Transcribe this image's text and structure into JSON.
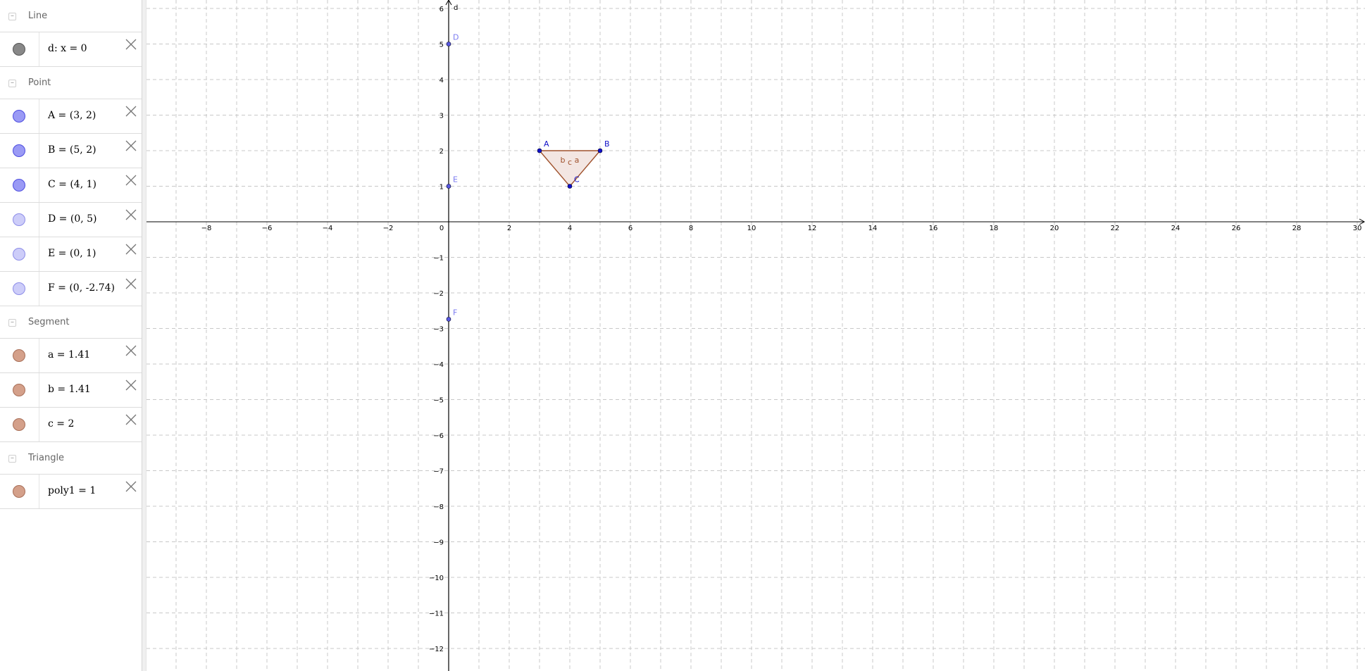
{
  "algebra": {
    "groups": [
      {
        "label": "Line",
        "items": [
          {
            "text": "d: x = 0",
            "color": "#888888",
            "border": "#555555"
          }
        ]
      },
      {
        "label": "Point",
        "items": [
          {
            "text": "A = (3, 2)",
            "color": "#9a9af5",
            "border": "#4d4de0"
          },
          {
            "text": "B = (5, 2)",
            "color": "#9a9af5",
            "border": "#4d4de0"
          },
          {
            "text": "C = (4, 1)",
            "color": "#9a9af5",
            "border": "#4d4de0"
          },
          {
            "text": "D = (0, 5)",
            "color": "#cdcdf9",
            "border": "#8d8de8"
          },
          {
            "text": "E = (0, 1)",
            "color": "#cdcdf9",
            "border": "#8d8de8"
          },
          {
            "text": "F = (0, -2.74)",
            "color": "#cdcdf9",
            "border": "#8d8de8"
          }
        ]
      },
      {
        "label": "Segment",
        "items": [
          {
            "text": "a = 1.41",
            "color": "#d4a08a",
            "border": "#a86f58"
          },
          {
            "text": "b = 1.41",
            "color": "#d4a08a",
            "border": "#a86f58"
          },
          {
            "text": "c = 2",
            "color": "#d4a08a",
            "border": "#a86f58"
          }
        ]
      },
      {
        "label": "Triangle",
        "items": [
          {
            "text": "poly1 = 1",
            "color": "#d4a08a",
            "border": "#a86f58"
          }
        ]
      }
    ]
  },
  "graphics": {
    "x_ticks": [
      "-8",
      "-6",
      "-4",
      "-2",
      "0",
      "2",
      "4",
      "6",
      "8",
      "10",
      "12",
      "14",
      "16",
      "18",
      "20",
      "22",
      "24",
      "26",
      "28",
      "30"
    ],
    "y_ticks": [
      "6",
      "5",
      "4",
      "3",
      "2",
      "1",
      "-1",
      "-2",
      "-3",
      "-4",
      "-5",
      "-6",
      "-7",
      "-8",
      "-9",
      "-10",
      "-11",
      "-12"
    ],
    "line": {
      "label": "d"
    },
    "points": [
      {
        "label": "A",
        "x": 3,
        "y": 2,
        "color": "#1010c8",
        "label_color": "#1010c8"
      },
      {
        "label": "B",
        "x": 5,
        "y": 2,
        "color": "#1010c8",
        "label_color": "#1010c8"
      },
      {
        "label": "C",
        "x": 4,
        "y": 1,
        "color": "#1010c8",
        "label_color": "#1010c8"
      },
      {
        "label": "D",
        "x": 0,
        "y": 5,
        "color": "#5a5ae0",
        "label_color": "#7a7af0"
      },
      {
        "label": "E",
        "x": 0,
        "y": 1,
        "color": "#5a5ae0",
        "label_color": "#7a7af0"
      },
      {
        "label": "F",
        "x": 0,
        "y": -2.74,
        "color": "#5a5ae0",
        "label_color": "#7a7af0"
      }
    ],
    "segment_labels": [
      "b",
      "c",
      "a"
    ],
    "triangle": {
      "fill": "#f3e6e2",
      "stroke": "#a0522d"
    }
  }
}
